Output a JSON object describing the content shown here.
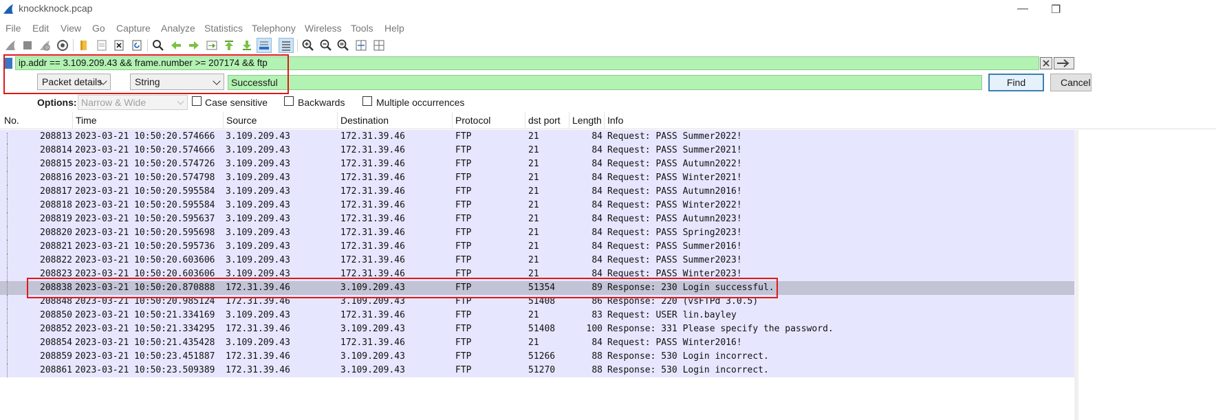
{
  "window": {
    "title": "knockknock.pcap"
  },
  "menu": [
    "File",
    "Edit",
    "View",
    "Go",
    "Capture",
    "Analyze",
    "Statistics",
    "Telephony",
    "Wireless",
    "Tools",
    "Help"
  ],
  "display_filter": {
    "value": "ip.addr == 3.109.209.43 && frame.number >= 207174 && ftp"
  },
  "find": {
    "search_in": "Packet details",
    "search_type": "String",
    "query": "Successful",
    "find_label": "Find",
    "cancel_label": "Cancel"
  },
  "options": {
    "label": "Options:",
    "charset": "Narrow & Wide",
    "case_sensitive": "Case sensitive",
    "backwards": "Backwards",
    "multiple": "Multiple occurrences"
  },
  "columns": [
    "No.",
    "Time",
    "Source",
    "Destination",
    "Protocol",
    "dst port",
    "Length",
    "Info"
  ],
  "rows": [
    {
      "no": "208813",
      "time": "2023-03-21 10:50:20.574666",
      "src": "3.109.209.43",
      "dst": "172.31.39.46",
      "proto": "FTP",
      "dport": "21",
      "len": "84",
      "info": "Request: PASS Summer2022!"
    },
    {
      "no": "208814",
      "time": "2023-03-21 10:50:20.574666",
      "src": "3.109.209.43",
      "dst": "172.31.39.46",
      "proto": "FTP",
      "dport": "21",
      "len": "84",
      "info": "Request: PASS Summer2021!"
    },
    {
      "no": "208815",
      "time": "2023-03-21 10:50:20.574726",
      "src": "3.109.209.43",
      "dst": "172.31.39.46",
      "proto": "FTP",
      "dport": "21",
      "len": "84",
      "info": "Request: PASS Autumn2022!"
    },
    {
      "no": "208816",
      "time": "2023-03-21 10:50:20.574798",
      "src": "3.109.209.43",
      "dst": "172.31.39.46",
      "proto": "FTP",
      "dport": "21",
      "len": "84",
      "info": "Request: PASS Winter2021!"
    },
    {
      "no": "208817",
      "time": "2023-03-21 10:50:20.595584",
      "src": "3.109.209.43",
      "dst": "172.31.39.46",
      "proto": "FTP",
      "dport": "21",
      "len": "84",
      "info": "Request: PASS Autumn2016!"
    },
    {
      "no": "208818",
      "time": "2023-03-21 10:50:20.595584",
      "src": "3.109.209.43",
      "dst": "172.31.39.46",
      "proto": "FTP",
      "dport": "21",
      "len": "84",
      "info": "Request: PASS Winter2022!"
    },
    {
      "no": "208819",
      "time": "2023-03-21 10:50:20.595637",
      "src": "3.109.209.43",
      "dst": "172.31.39.46",
      "proto": "FTP",
      "dport": "21",
      "len": "84",
      "info": "Request: PASS Autumn2023!"
    },
    {
      "no": "208820",
      "time": "2023-03-21 10:50:20.595698",
      "src": "3.109.209.43",
      "dst": "172.31.39.46",
      "proto": "FTP",
      "dport": "21",
      "len": "84",
      "info": "Request: PASS Spring2023!"
    },
    {
      "no": "208821",
      "time": "2023-03-21 10:50:20.595736",
      "src": "3.109.209.43",
      "dst": "172.31.39.46",
      "proto": "FTP",
      "dport": "21",
      "len": "84",
      "info": "Request: PASS Summer2016!"
    },
    {
      "no": "208822",
      "time": "2023-03-21 10:50:20.603606",
      "src": "3.109.209.43",
      "dst": "172.31.39.46",
      "proto": "FTP",
      "dport": "21",
      "len": "84",
      "info": "Request: PASS Summer2023!"
    },
    {
      "no": "208823",
      "time": "2023-03-21 10:50:20.603606",
      "src": "3.109.209.43",
      "dst": "172.31.39.46",
      "proto": "FTP",
      "dport": "21",
      "len": "84",
      "info": "Request: PASS Winter2023!"
    },
    {
      "no": "208838",
      "time": "2023-03-21 10:50:20.870888",
      "src": "172.31.39.46",
      "dst": "3.109.209.43",
      "proto": "FTP",
      "dport": "51354",
      "len": "89",
      "info": "Response: 230 Login successful."
    },
    {
      "no": "208848",
      "time": "2023-03-21 10:50:20.985124",
      "src": "172.31.39.46",
      "dst": "3.109.209.43",
      "proto": "FTP",
      "dport": "51408",
      "len": "86",
      "info": "Response: 220 (vsFTPd 3.0.5)"
    },
    {
      "no": "208850",
      "time": "2023-03-21 10:50:21.334169",
      "src": "3.109.209.43",
      "dst": "172.31.39.46",
      "proto": "FTP",
      "dport": "21",
      "len": "83",
      "info": "Request: USER lin.bayley"
    },
    {
      "no": "208852",
      "time": "2023-03-21 10:50:21.334295",
      "src": "172.31.39.46",
      "dst": "3.109.209.43",
      "proto": "FTP",
      "dport": "51408",
      "len": "100",
      "info": "Response: 331 Please specify the password."
    },
    {
      "no": "208854",
      "time": "2023-03-21 10:50:21.435428",
      "src": "3.109.209.43",
      "dst": "172.31.39.46",
      "proto": "FTP",
      "dport": "21",
      "len": "84",
      "info": "Request: PASS Winter2016!"
    },
    {
      "no": "208859",
      "time": "2023-03-21 10:50:23.451887",
      "src": "172.31.39.46",
      "dst": "3.109.209.43",
      "proto": "FTP",
      "dport": "51266",
      "len": "88",
      "info": "Response: 530 Login incorrect."
    },
    {
      "no": "208861",
      "time": "2023-03-21 10:50:23.509389",
      "src": "172.31.39.46",
      "dst": "3.109.209.43",
      "proto": "FTP",
      "dport": "51270",
      "len": "88",
      "info": "Response: 530 Login incorrect."
    }
  ],
  "selected_row": 11,
  "colors": {
    "row_bg": "#e7e6ff",
    "selected_bg": "#c3c3d6",
    "filter_valid": "#b2f2b2",
    "annotation": "#e01818"
  }
}
